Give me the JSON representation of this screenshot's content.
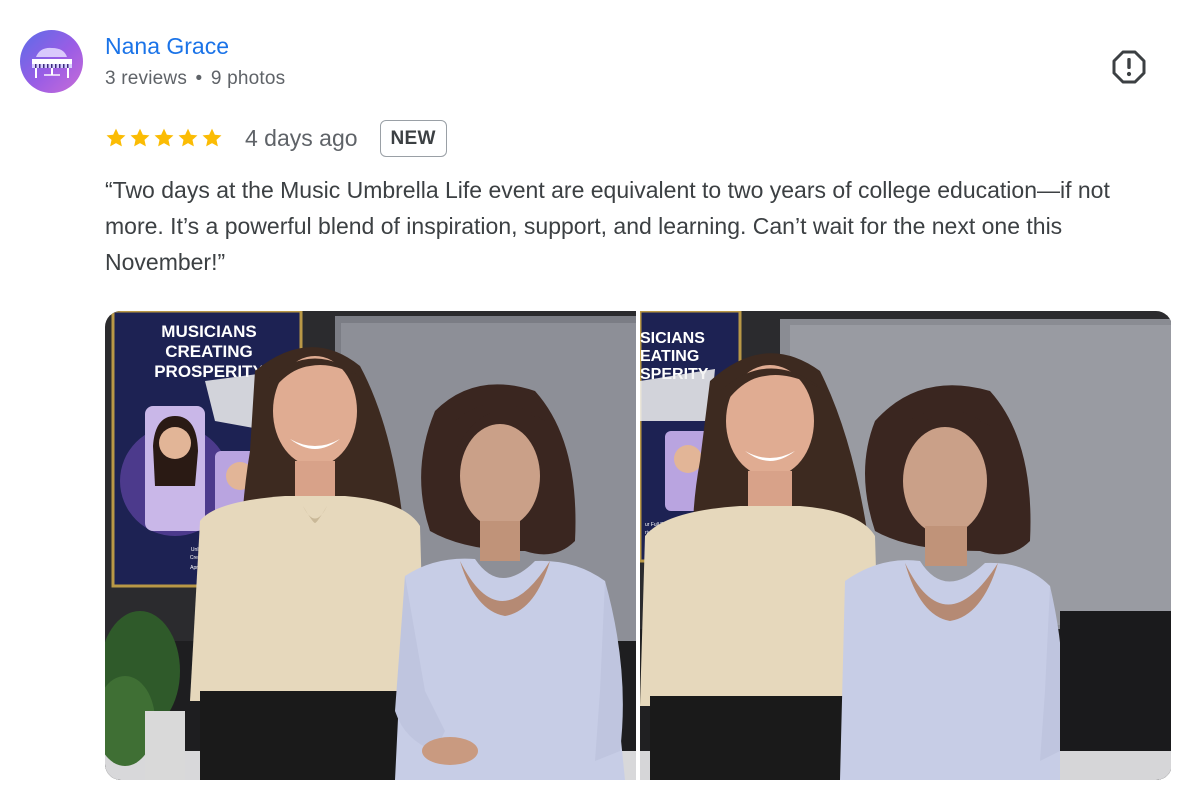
{
  "review": {
    "author": {
      "name": "Nana Grace",
      "reviews": "3 reviews",
      "separator": "•",
      "photos": "9 photos",
      "avatar_icon": "piano-icon"
    },
    "report_icon": "report-icon",
    "rating": 5,
    "time": "4 days ago",
    "badge": "NEW",
    "text": "“Two days at the Music Umbrella Life event are equivalent to two years of college education—if not more. It’s a powerful blend of inspiration, support, and learning. Can’t wait for the next one this November!”",
    "photos": [
      {
        "poster_lines": [
          "MUSICIANS",
          "CREATING",
          "PROSPERITY"
        ],
        "poster_small": [
          "Unlock Your Full",
          "Create a Thriving",
          "April 10-11, 2025"
        ]
      },
      {
        "poster_lines": [
          "SICIANS",
          "EATING",
          "SPERITY"
        ],
        "poster_small": [
          "ur Full Pot",
          "riving"
        ]
      }
    ]
  },
  "colors": {
    "link": "#1a73e8",
    "star": "#fbbc04",
    "meta": "#5f6368",
    "text": "#3c4043"
  }
}
